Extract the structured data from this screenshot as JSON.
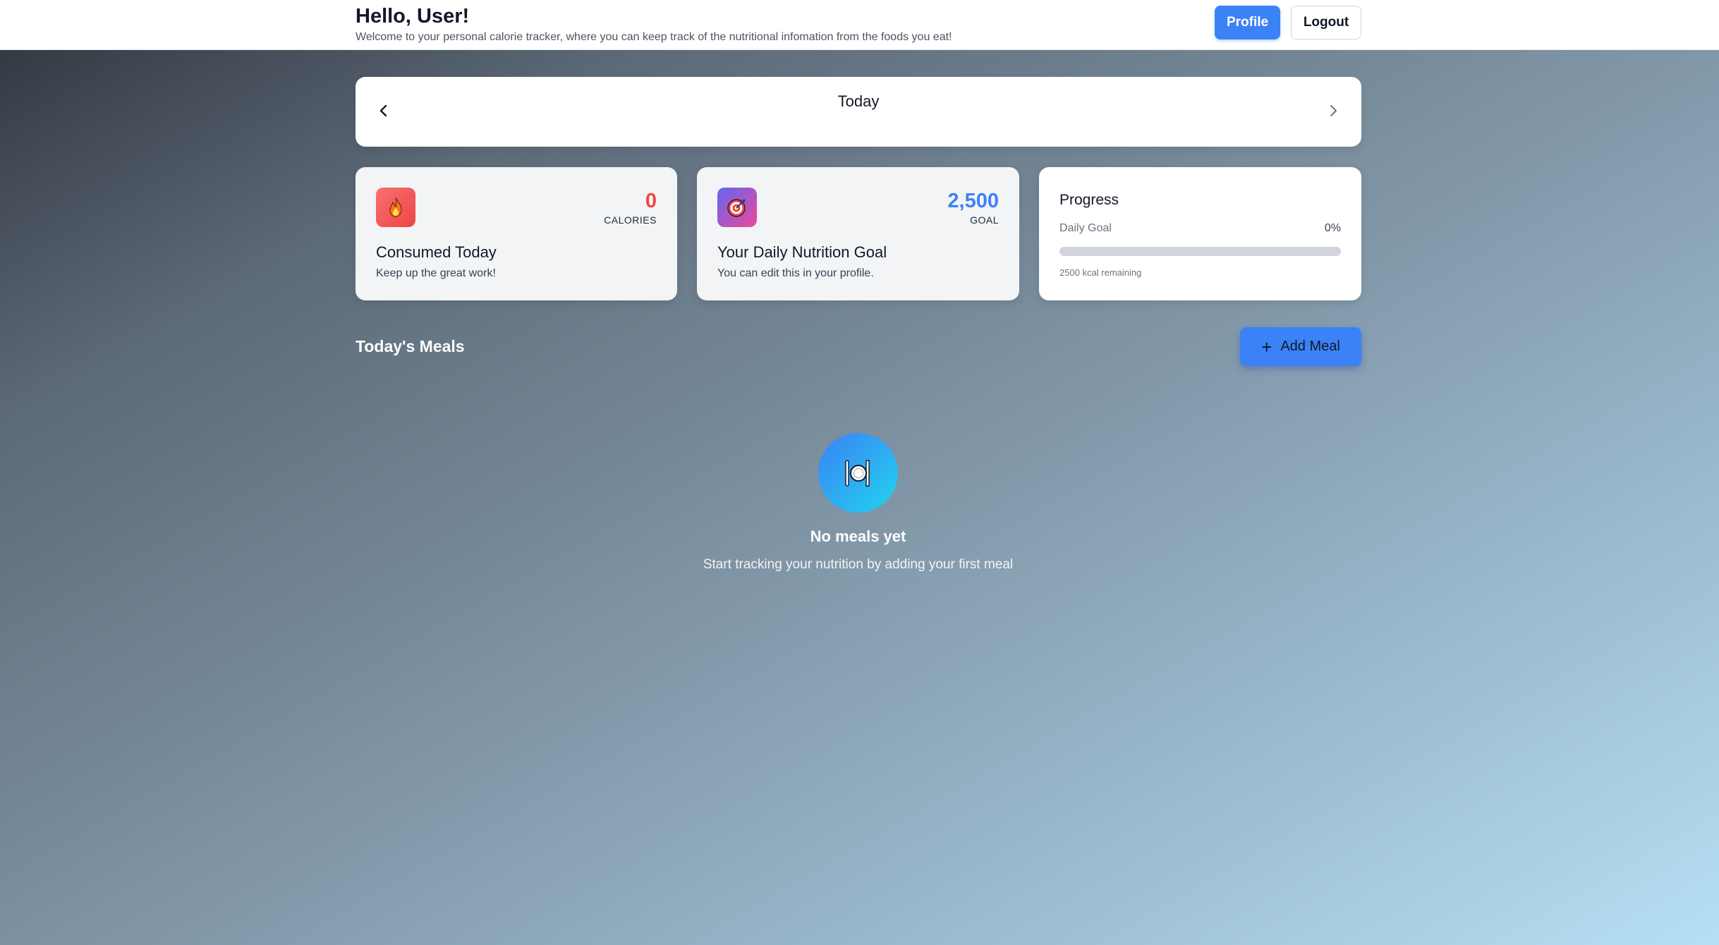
{
  "header": {
    "greeting": "Hello, User!",
    "subtitle": "Welcome to your personal calorie tracker, where you can keep track of the nutritional infomation from the foods you eat!",
    "profile_label": "Profile",
    "logout_label": "Logout"
  },
  "date_nav": {
    "label": "Today",
    "prev_icon": "chevron-left-icon",
    "next_icon": "chevron-right-icon"
  },
  "consumed": {
    "icon": "fire-icon",
    "value": "0",
    "unit": "CALORIES",
    "title": "Consumed Today",
    "description": "Keep up the great work!"
  },
  "goal": {
    "icon": "target-icon",
    "value": "2,500",
    "unit": "GOAL",
    "title": "Your Daily Nutrition Goal",
    "description": "You can edit this in your profile."
  },
  "progress": {
    "title": "Progress",
    "label": "Daily Goal",
    "percent_text": "0%",
    "percent": 0,
    "remaining": "2500 kcal remaining"
  },
  "meals": {
    "title": "Today's Meals",
    "add_label": "Add Meal",
    "empty_icon": "plate-cutlery-icon",
    "empty_title": "No meals yet",
    "empty_description": "Start tracking your nutrition by adding your first meal"
  },
  "colors": {
    "accent": "#3b82f6",
    "calories": "#ef4444",
    "goal": "#3b82f6"
  }
}
